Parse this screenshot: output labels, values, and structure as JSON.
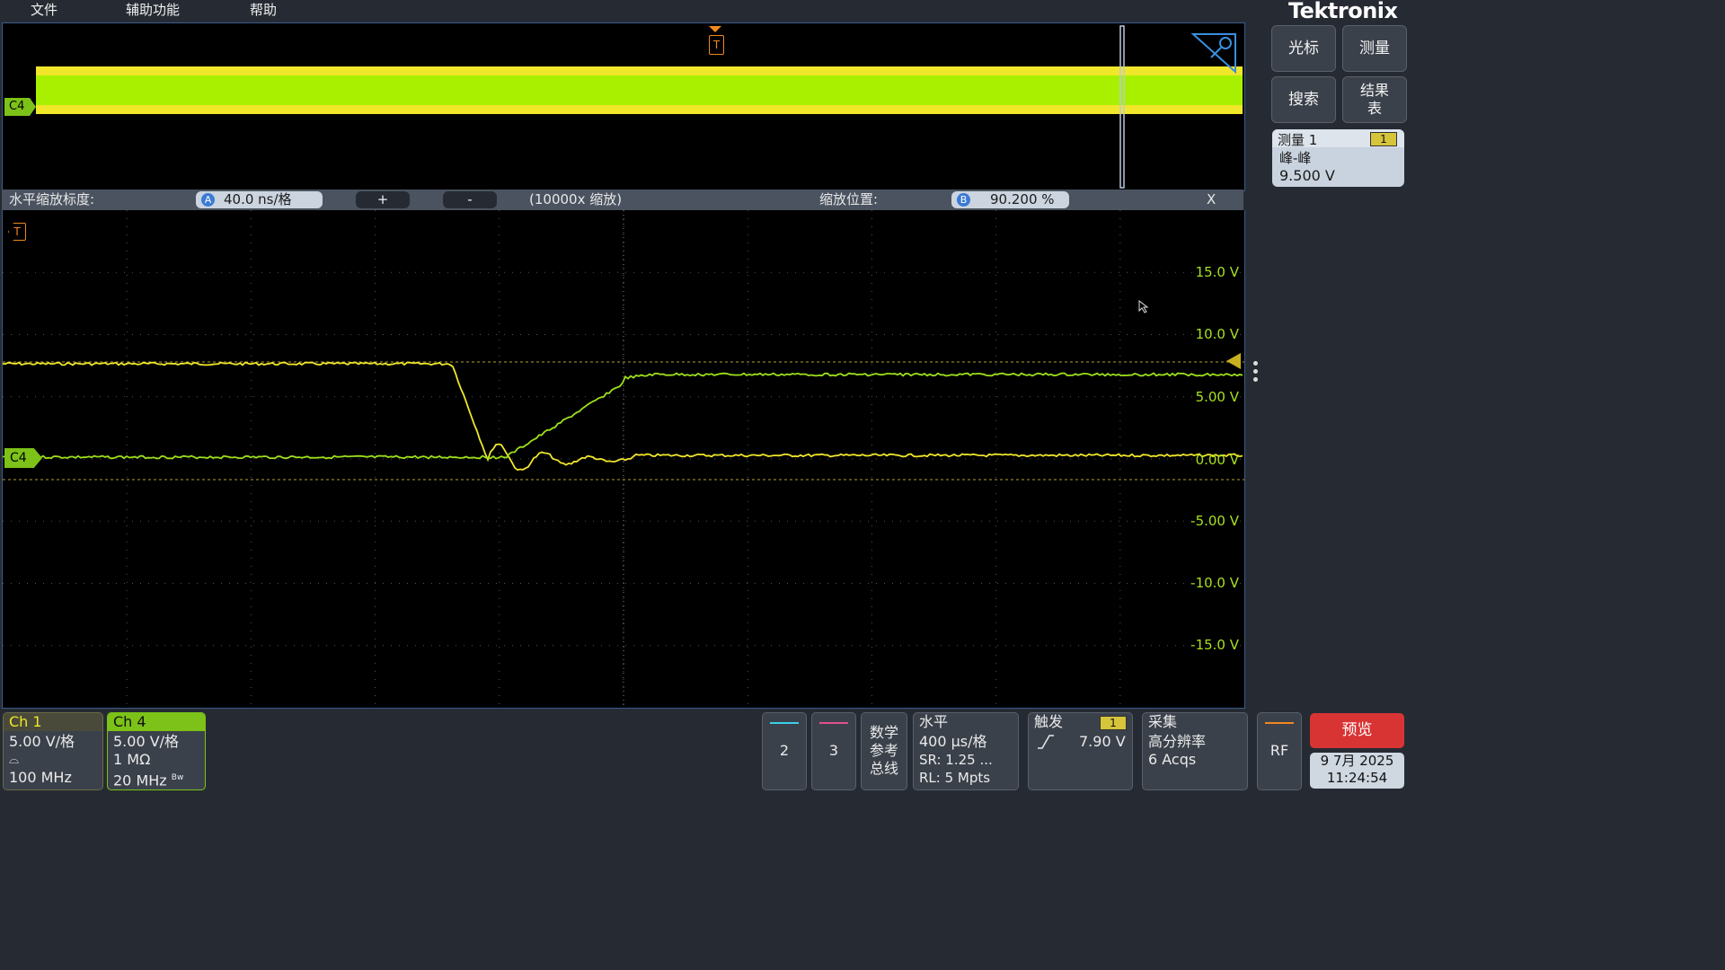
{
  "menu": [
    "文件",
    "辅助功能",
    "帮助"
  ],
  "brand": "Tektronix",
  "right_buttons": [
    "光标",
    "测量",
    "搜索",
    "结果\n表"
  ],
  "measurement": {
    "title": "测量 1",
    "badge": "1",
    "type": "峰-峰",
    "value": "9.500 V"
  },
  "zoom": {
    "label": "水平缩放标度:",
    "a_badge": "A",
    "scale": "40.0 ns/格",
    "plus": "+",
    "minus": "-",
    "factor": "(10000x 缩放)",
    "pos_label": "缩放位置:",
    "b_badge": "B",
    "position": "90.200 %",
    "close": "X"
  },
  "trigger_marker": "T",
  "channel_marker": "C4",
  "y_axis_labels": [
    "15.0 V",
    "10.0 V",
    "5.00 V",
    "0.00 V",
    "-5.00 V",
    "-10.0 V",
    "-15.0 V"
  ],
  "colors": {
    "ch1": "#f0e62a",
    "ch4": "#9ee01a",
    "trigger": "#f0881e",
    "accent": "#3b7ad6",
    "preview": "#d83434"
  },
  "ch1": {
    "label": "Ch 1",
    "scale": "5.00 V/格",
    "icon": "probe-icon",
    "bw": "100 MHz"
  },
  "ch4": {
    "label": "Ch 4",
    "scale": "5.00 V/格",
    "impedance": "1 MΩ",
    "bw": "20 MHz",
    "bw_sub": "Bw"
  },
  "slots": [
    "2",
    "3"
  ],
  "math": "数学\n参考\n总线",
  "horizontal": {
    "title": "水平",
    "scale": "400 µs/格",
    "sr": "SR: 1.25 ...",
    "rl": "RL: 5 Mpts"
  },
  "trigger": {
    "title": "触发",
    "badge": "1",
    "level": "7.90 V",
    "icon": "rising-edge-icon"
  },
  "acquire": {
    "title": "采集",
    "mode": "高分辨率",
    "count": "6 Acqs"
  },
  "rf": "RF",
  "preview": "预览",
  "datetime": {
    "date": "9 7月 2025",
    "time": "11:24:54"
  }
}
